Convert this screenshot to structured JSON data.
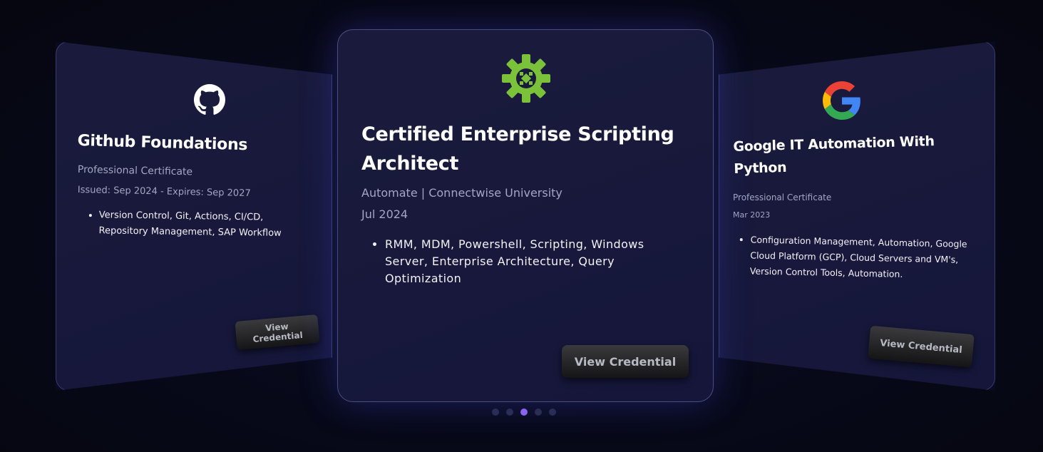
{
  "carousel": {
    "cards": [
      {
        "logo": "github-icon",
        "title": "Github Foundations",
        "subtitle": "Professional Certificate",
        "date": "Issued: Sep 2024 - Expires: Sep 2027",
        "bullets": [
          "Version Control, Git, Actions, CI/CD, Repository Management, SAP Workflow"
        ],
        "button_label": "View Credential"
      },
      {
        "logo": "gear-icon",
        "title": "Certified Enterprise Scripting Architect",
        "subtitle": "Automate | Connectwise University",
        "date": "Jul 2024",
        "bullets": [
          "RMM, MDM, Powershell, Scripting, Windows Server, Enterprise Architecture, Query Optimization"
        ],
        "button_label": "View Credential"
      },
      {
        "logo": "google-icon",
        "title": "Google IT Automation With Python",
        "subtitle": "Professional Certificate",
        "date": "Mar 2023",
        "bullets": [
          "Configuration Management, Automation, Google Cloud Platform (GCP), Cloud Servers and VM's, Version Control Tools, Automation."
        ],
        "button_label": "View Credential"
      }
    ],
    "pagination": {
      "total": 5,
      "active_index": 2
    }
  },
  "colors": {
    "background": "#060816",
    "card": "#1a1b3c",
    "accent_dot": "#8a63f0",
    "gear_green": "#7cc13a"
  }
}
